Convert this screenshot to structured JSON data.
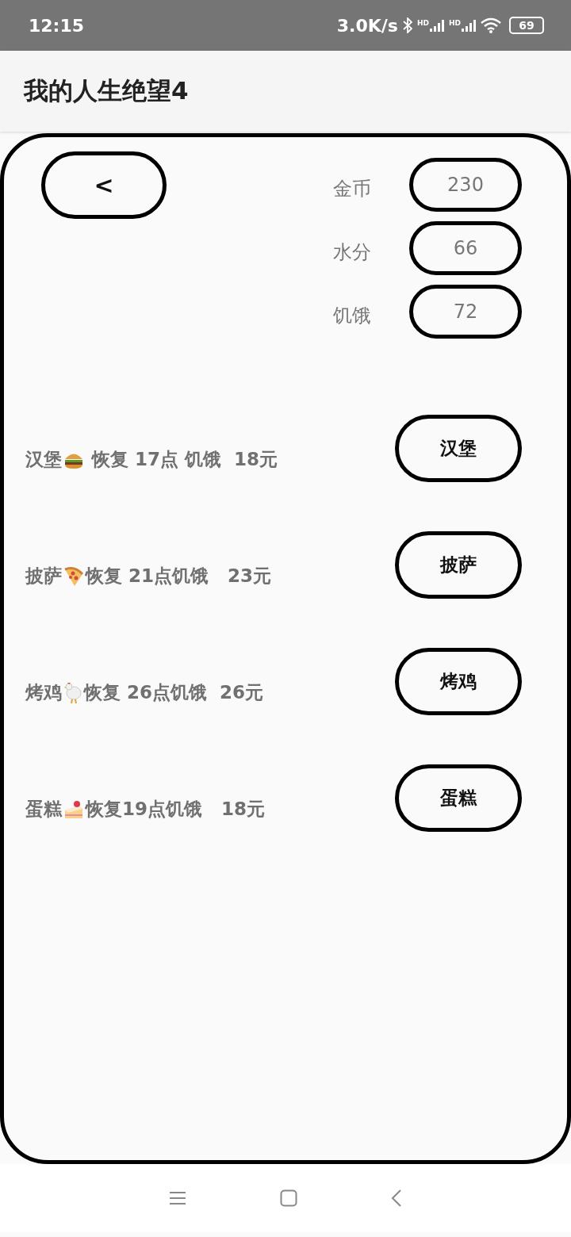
{
  "status_bar": {
    "time": "12:15",
    "speed": "3.0K/s",
    "sim_labels": [
      "HD",
      "HD"
    ],
    "battery": "69"
  },
  "app_bar": {
    "title": "我的人生绝望4"
  },
  "back_button": {
    "label": "<"
  },
  "stats": [
    {
      "label": "金币",
      "value": "230"
    },
    {
      "label": "水分",
      "value": "66"
    },
    {
      "label": "饥饿",
      "value": "72"
    }
  ],
  "foods": [
    {
      "name": "汉堡",
      "kind": "burger",
      "detail": " 恢复 17点 饥饿  18元",
      "button": "汉堡"
    },
    {
      "name": "披萨",
      "kind": "pizza",
      "detail": "恢复 21点饥饿   23元",
      "button": "披萨"
    },
    {
      "name": "烤鸡",
      "kind": "chicken",
      "detail": "恢复 26点饥饿  26元",
      "button": "烤鸡"
    },
    {
      "name": "蛋糕",
      "kind": "cake",
      "detail": "恢复19点饥饿   18元",
      "button": "蛋糕"
    }
  ]
}
